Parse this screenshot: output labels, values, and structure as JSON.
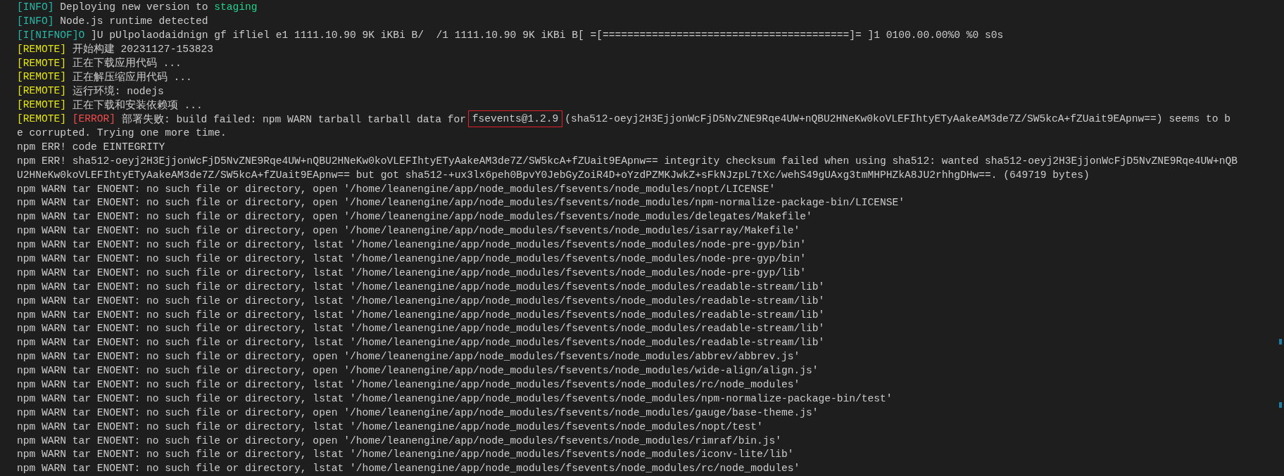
{
  "terminal": {
    "lines": [
      {
        "segments": [
          {
            "kind": "info-tag",
            "text": "[INFO]"
          },
          {
            "kind": "plain",
            "text": "Deploying new version to"
          },
          {
            "kind": "highlight",
            "text": "staging"
          }
        ]
      },
      {
        "segments": [
          {
            "kind": "info-tag",
            "text": "[INFO]"
          },
          {
            "kind": "plain",
            "text": "Node.js runtime detected"
          }
        ]
      },
      {
        "segments": [
          {
            "kind": "info-tag",
            "text": "[I[NIFNOF]O"
          },
          {
            "kind": "plain",
            "text": "]U pUlpolaodaidnign gf ifliel e1 1111.10.90 9K iKBi B/  /1 1111.10.90 9K iKBi B[ =[========================================]= ]1 0100.00.00%0 %0 s0s"
          }
        ]
      },
      {
        "segments": [
          {
            "kind": "remote-tag",
            "text": "[REMOTE]"
          },
          {
            "kind": "plain",
            "text": "开始构建 20231127-153823"
          }
        ]
      },
      {
        "segments": [
          {
            "kind": "remote-tag",
            "text": "[REMOTE]"
          },
          {
            "kind": "plain",
            "text": "正在下载应用代码 ..."
          }
        ]
      },
      {
        "segments": [
          {
            "kind": "remote-tag",
            "text": "[REMOTE]"
          },
          {
            "kind": "plain",
            "text": "正在解压缩应用代码 ..."
          }
        ]
      },
      {
        "segments": [
          {
            "kind": "remote-tag",
            "text": "[REMOTE]"
          },
          {
            "kind": "plain",
            "text": "运行环境: nodejs"
          }
        ]
      },
      {
        "segments": [
          {
            "kind": "remote-tag",
            "text": "[REMOTE]"
          },
          {
            "kind": "plain",
            "text": "正在下载和安装依赖项 ..."
          }
        ]
      },
      {
        "segments": [
          {
            "kind": "remote-tag",
            "text": "[REMOTE]"
          },
          {
            "kind": "error-tag",
            "text": "[ERROR]"
          },
          {
            "kind": "plain",
            "text": "部署失败: build failed: npm WARN tarball tarball data for"
          },
          {
            "kind": "boxed",
            "text": "fsevents@1.2.9"
          },
          {
            "kind": "plain",
            "text": "(sha512-oeyj2H3EjjonWcFjD5NvZNE9Rqe4UW+nQBU2HNeKw0koVLEFIhtyETyAakeAM3de7Z/SW5kcA+fZUait9EApnw==) seems to b"
          }
        ]
      },
      {
        "segments": [
          {
            "kind": "plain",
            "text": "e corrupted. Trying one more time."
          }
        ]
      },
      {
        "segments": [
          {
            "kind": "plain",
            "text": "npm ERR! code EINTEGRITY"
          }
        ]
      },
      {
        "segments": [
          {
            "kind": "plain",
            "text": "npm ERR! sha512-oeyj2H3EjjonWcFjD5NvZNE9Rqe4UW+nQBU2HNeKw0koVLEFIhtyETyAakeAM3de7Z/SW5kcA+fZUait9EApnw== integrity checksum failed when using sha512: wanted sha512-oeyj2H3EjjonWcFjD5NvZNE9Rqe4UW+nQB"
          }
        ]
      },
      {
        "segments": [
          {
            "kind": "plain",
            "text": "U2HNeKw0koVLEFIhtyETyAakeAM3de7Z/SW5kcA+fZUait9EApnw== but got sha512-+ux3lx6peh0BpvY0JebGyZoiR4D+oYzdPZMKJwkZ+sFkNJzpL7tXc/wehS49gUAxg3tmMHPHZkA8JU2rhhgDHw==. (649719 bytes)"
          }
        ]
      },
      {
        "segments": [
          {
            "kind": "plain",
            "text": "npm WARN tar ENOENT: no such file or directory, open '/home/leanengine/app/node_modules/fsevents/node_modules/nopt/LICENSE'"
          }
        ]
      },
      {
        "segments": [
          {
            "kind": "plain",
            "text": "npm WARN tar ENOENT: no such file or directory, open '/home/leanengine/app/node_modules/fsevents/node_modules/npm-normalize-package-bin/LICENSE'"
          }
        ]
      },
      {
        "segments": [
          {
            "kind": "plain",
            "text": "npm WARN tar ENOENT: no such file or directory, open '/home/leanengine/app/node_modules/fsevents/node_modules/delegates/Makefile'"
          }
        ]
      },
      {
        "segments": [
          {
            "kind": "plain",
            "text": "npm WARN tar ENOENT: no such file or directory, open '/home/leanengine/app/node_modules/fsevents/node_modules/isarray/Makefile'"
          }
        ]
      },
      {
        "segments": [
          {
            "kind": "plain",
            "text": "npm WARN tar ENOENT: no such file or directory, lstat '/home/leanengine/app/node_modules/fsevents/node_modules/node-pre-gyp/bin'"
          }
        ]
      },
      {
        "segments": [
          {
            "kind": "plain",
            "text": "npm WARN tar ENOENT: no such file or directory, lstat '/home/leanengine/app/node_modules/fsevents/node_modules/node-pre-gyp/bin'"
          }
        ]
      },
      {
        "segments": [
          {
            "kind": "plain",
            "text": "npm WARN tar ENOENT: no such file or directory, lstat '/home/leanengine/app/node_modules/fsevents/node_modules/node-pre-gyp/lib'"
          }
        ]
      },
      {
        "segments": [
          {
            "kind": "plain",
            "text": "npm WARN tar ENOENT: no such file or directory, lstat '/home/leanengine/app/node_modules/fsevents/node_modules/readable-stream/lib'"
          }
        ]
      },
      {
        "segments": [
          {
            "kind": "plain",
            "text": "npm WARN tar ENOENT: no such file or directory, lstat '/home/leanengine/app/node_modules/fsevents/node_modules/readable-stream/lib'"
          }
        ]
      },
      {
        "segments": [
          {
            "kind": "plain",
            "text": "npm WARN tar ENOENT: no such file or directory, lstat '/home/leanengine/app/node_modules/fsevents/node_modules/readable-stream/lib'"
          }
        ]
      },
      {
        "segments": [
          {
            "kind": "plain",
            "text": "npm WARN tar ENOENT: no such file or directory, lstat '/home/leanengine/app/node_modules/fsevents/node_modules/readable-stream/lib'"
          }
        ]
      },
      {
        "segments": [
          {
            "kind": "plain",
            "text": "npm WARN tar ENOENT: no such file or directory, lstat '/home/leanengine/app/node_modules/fsevents/node_modules/readable-stream/lib'"
          }
        ]
      },
      {
        "segments": [
          {
            "kind": "plain",
            "text": "npm WARN tar ENOENT: no such file or directory, open '/home/leanengine/app/node_modules/fsevents/node_modules/abbrev/abbrev.js'"
          }
        ]
      },
      {
        "segments": [
          {
            "kind": "plain",
            "text": "npm WARN tar ENOENT: no such file or directory, open '/home/leanengine/app/node_modules/fsevents/node_modules/wide-align/align.js'"
          }
        ]
      },
      {
        "segments": [
          {
            "kind": "plain",
            "text": "npm WARN tar ENOENT: no such file or directory, lstat '/home/leanengine/app/node_modules/fsevents/node_modules/rc/node_modules'"
          }
        ]
      },
      {
        "segments": [
          {
            "kind": "plain",
            "text": "npm WARN tar ENOENT: no such file or directory, lstat '/home/leanengine/app/node_modules/fsevents/node_modules/npm-normalize-package-bin/test'"
          }
        ]
      },
      {
        "segments": [
          {
            "kind": "plain",
            "text": "npm WARN tar ENOENT: no such file or directory, open '/home/leanengine/app/node_modules/fsevents/node_modules/gauge/base-theme.js'"
          }
        ]
      },
      {
        "segments": [
          {
            "kind": "plain",
            "text": "npm WARN tar ENOENT: no such file or directory, lstat '/home/leanengine/app/node_modules/fsevents/node_modules/nopt/test'"
          }
        ]
      },
      {
        "segments": [
          {
            "kind": "plain",
            "text": "npm WARN tar ENOENT: no such file or directory, open '/home/leanengine/app/node_modules/fsevents/node_modules/rimraf/bin.js'"
          }
        ]
      },
      {
        "segments": [
          {
            "kind": "plain",
            "text": "npm WARN tar ENOENT: no such file or directory, lstat '/home/leanengine/app/node_modules/fsevents/node_modules/iconv-lite/lib'"
          }
        ]
      },
      {
        "segments": [
          {
            "kind": "plain",
            "text": "npm WARN tar ENOENT: no such file or directory, lstat '/home/leanengine/app/node_modules/fsevents/node_modules/rc/node_modules'"
          }
        ]
      }
    ]
  }
}
